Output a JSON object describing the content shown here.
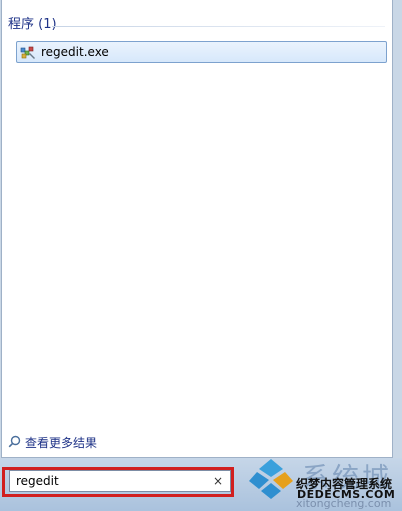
{
  "results": {
    "section_title": "程序 (1)",
    "items": [
      {
        "label": "regedit.exe",
        "icon": "regedit-icon"
      }
    ]
  },
  "see_more": {
    "label": "查看更多结果",
    "icon": "search-icon"
  },
  "search": {
    "value": "regedit",
    "clear_label": "×"
  },
  "watermark": {
    "big_text": "系统城",
    "line1": "织梦内容管理系统",
    "line2": "DEDECMS.COM",
    "line3": "xitongcheng.com"
  },
  "colors": {
    "highlight": "#d11f1f",
    "accent": "#1e3287"
  }
}
